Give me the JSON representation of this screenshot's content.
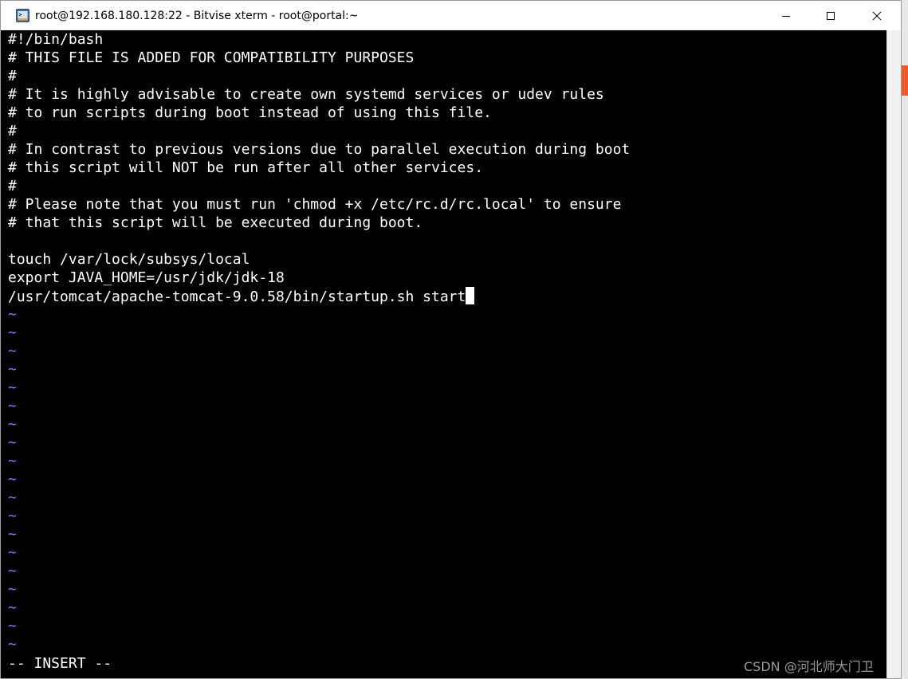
{
  "window": {
    "title": "root@192.168.180.128:22 - Bitvise xterm - root@portal:~",
    "icon": "bitvise-terminal-icon",
    "controls": {
      "minimize_icon": "minimize-icon",
      "maximize_icon": "maximize-icon",
      "close_icon": "close-icon"
    }
  },
  "terminal": {
    "lines": [
      "#!/bin/bash",
      "# THIS FILE IS ADDED FOR COMPATIBILITY PURPOSES",
      "#",
      "# It is highly advisable to create own systemd services or udev rules",
      "# to run scripts during boot instead of using this file.",
      "#",
      "# In contrast to previous versions due to parallel execution during boot",
      "# this script will NOT be run after all other services.",
      "#",
      "# Please note that you must run 'chmod +x /etc/rc.d/rc.local' to ensure",
      "# that this script will be executed during boot.",
      "",
      "touch /var/lock/subsys/local",
      "export JAVA_HOME=/usr/jdk/jdk-18",
      "/usr/tomcat/apache-tomcat-9.0.58/bin/startup.sh start"
    ],
    "tilde_char": "~",
    "tilde_count": 19,
    "cursor_line": 14,
    "mode_indicator": "-- INSERT --",
    "colors": {
      "background": "#000000",
      "text": "#ffffff",
      "tilde": "#7b7bff"
    }
  },
  "watermark": "CSDN @河北师大门卫"
}
